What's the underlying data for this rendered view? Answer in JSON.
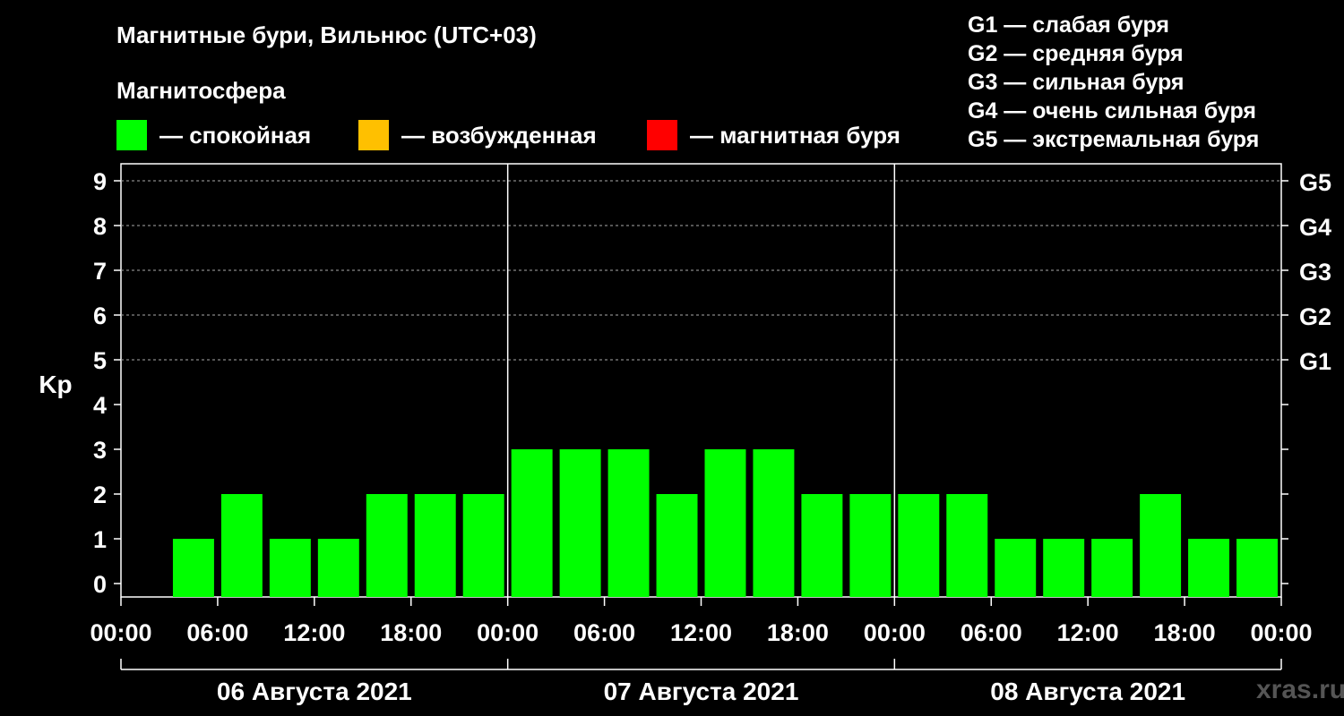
{
  "header": {
    "title": "Магнитные бури, Вильнюс (UTC+03)",
    "subtitle": "Магнитосфера"
  },
  "legend": [
    {
      "color": "#00ff00",
      "label": "— спокойная"
    },
    {
      "color": "#ffc000",
      "label": "— возбужденная"
    },
    {
      "color": "#ff0000",
      "label": "— магнитная буря"
    }
  ],
  "g_scale": [
    "G1 — слабая буря",
    "G2 — средняя буря",
    "G3 — сильная буря",
    "G4 — очень сильная буря",
    "G5 — экстремальная буря"
  ],
  "watermark": "xras.ru",
  "chart_data": {
    "type": "bar",
    "ylabel": "Kp",
    "ylim": [
      0,
      9
    ],
    "yticks": [
      0,
      1,
      2,
      3,
      4,
      5,
      6,
      7,
      8,
      9
    ],
    "right_labels": [
      {
        "kp": 5,
        "label": "G1"
      },
      {
        "kp": 6,
        "label": "G2"
      },
      {
        "kp": 7,
        "label": "G3"
      },
      {
        "kp": 8,
        "label": "G4"
      },
      {
        "kp": 9,
        "label": "G5"
      }
    ],
    "xticks": [
      "00:00",
      "06:00",
      "12:00",
      "18:00",
      "00:00",
      "06:00",
      "12:00",
      "18:00",
      "00:00",
      "06:00",
      "12:00",
      "18:00",
      "00:00"
    ],
    "days": [
      "06 Августа 2021",
      "07 Августа 2021",
      "08 Августа 2021"
    ],
    "bar_color": "#00ff00",
    "grid": true,
    "values": [
      null,
      1,
      2,
      1,
      1,
      2,
      2,
      2,
      3,
      3,
      3,
      2,
      3,
      3,
      2,
      2,
      2,
      2,
      1,
      1,
      1,
      2,
      1,
      1
    ]
  }
}
